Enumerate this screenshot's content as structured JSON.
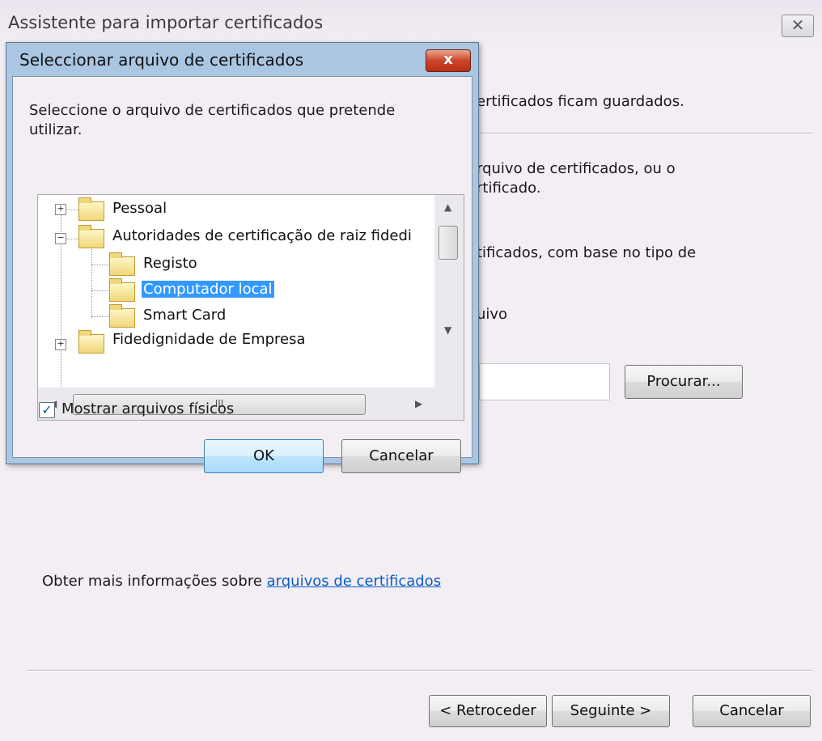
{
  "wizard": {
    "title": "Assistente para importar certificados",
    "close_glyph": "✕",
    "text_stored": "ertificados ficam guardados.",
    "text_select_line1": "rquivo de certificados, ou o",
    "text_select_line2": "rtificado.",
    "text_auto_line1": "tificados, com base no tipo de",
    "text_archive": "uivo",
    "browse_label": "Procurar...",
    "more_info_text": "Obter mais informações sobre ",
    "more_info_link": "arquivos de certificados",
    "back_label": "< Retroceder",
    "next_label": "Seguinte >",
    "cancel_label": "Cancelar"
  },
  "dialog": {
    "title": "Seleccionar arquivo de certificados",
    "close_glyph": "x",
    "prompt_line1": "Seleccione o arquivo de certificados que pretende",
    "prompt_line2": "utilizar.",
    "tree": [
      {
        "label": "Pessoal"
      },
      {
        "label": "Autoridades de certificação de raiz fidedi"
      },
      {
        "label": "Registo"
      },
      {
        "label": "Computador local"
      },
      {
        "label": "Smart Card"
      },
      {
        "label": "Fidedignidade de Empresa"
      }
    ],
    "selected_item": "Computador local",
    "hscroll_grip": "III",
    "show_physical_label": "Mostrar arquivos físicos",
    "show_physical_checked": true,
    "ok_label": "OK",
    "cancel_label": "Cancelar"
  }
}
